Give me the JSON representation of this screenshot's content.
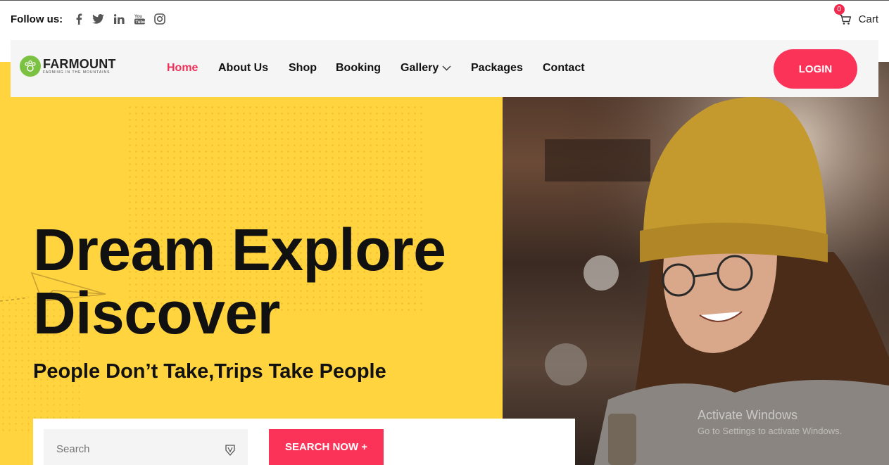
{
  "topbar": {
    "follow_label": "Follow us:",
    "social_icons": [
      "facebook-icon",
      "twitter-icon",
      "linkedin-icon",
      "youtube-icon",
      "instagram-icon"
    ],
    "cart_label": "Cart",
    "cart_count": "0"
  },
  "brand": {
    "name": "FARMOUNT",
    "tagline": "FARMING IN THE MOUNTAINS"
  },
  "nav": {
    "items": [
      {
        "label": "Home",
        "active": true
      },
      {
        "label": "About Us"
      },
      {
        "label": "Shop"
      },
      {
        "label": "Booking"
      },
      {
        "label": "Gallery",
        "has_dropdown": true
      },
      {
        "label": "Packages"
      },
      {
        "label": "Contact"
      }
    ],
    "login_label": "LOGIN"
  },
  "hero": {
    "headline_line1": "Dream Explore",
    "headline_line2": "Discover",
    "tagline": "People Don’t Take,Trips Take People"
  },
  "search": {
    "placeholder": "Search",
    "button_label": "SEARCH NOW +"
  },
  "watermark": {
    "title": "Activate Windows",
    "subtitle": "Go to Settings to activate Windows."
  },
  "colors": {
    "accent": "#fc3358",
    "hero_yellow": "#ffd43f",
    "brand_green": "#7cc242"
  }
}
